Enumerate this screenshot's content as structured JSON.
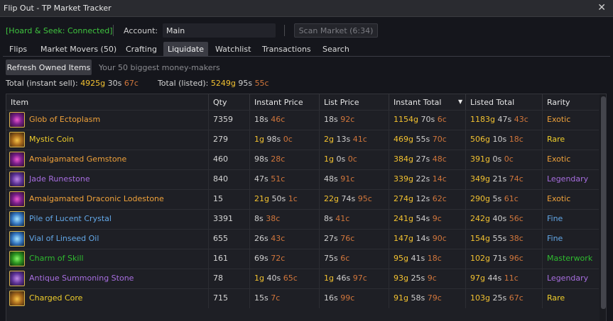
{
  "window": {
    "title": "Flip Out - TP Market Tracker",
    "close_glyph": "✕"
  },
  "connection": {
    "status": "[Hoard & Seek: Connected]",
    "color": "#3fc43f"
  },
  "account": {
    "label": "Account:",
    "value": "Main"
  },
  "scan_button": {
    "label": "Scan Market (6:34)"
  },
  "tabs": [
    {
      "label": "Flips",
      "active": false
    },
    {
      "label": "Market Movers (50)",
      "active": false
    },
    {
      "label": "Crafting",
      "active": false
    },
    {
      "label": "Liquidate",
      "active": true
    },
    {
      "label": "Watchlist",
      "active": false
    },
    {
      "label": "Transactions",
      "active": false
    },
    {
      "label": "Search",
      "active": false
    }
  ],
  "refresh_button": {
    "label": "Refresh Owned Items"
  },
  "hint": "Your 50 biggest money-makers",
  "totals": {
    "instant_label": "Total (instant sell):",
    "instant": {
      "g": "4925g",
      "s": "30s",
      "c": "67c"
    },
    "listed_label": "Total (listed):",
    "listed": {
      "g": "5249g",
      "s": "95s",
      "c": "55c"
    }
  },
  "table": {
    "columns": [
      "Item",
      "Qty",
      "Instant Price",
      "List Price",
      "Instant Total",
      "Listed Total",
      "Rarity"
    ],
    "sort_indicator": "▼",
    "rows": [
      {
        "icon": "glob-of-ectoplasm-icon",
        "name": "Glob of Ectoplasm",
        "qty": "7359",
        "instant": [
          "",
          "18s",
          "46c"
        ],
        "list": [
          "",
          "18s",
          "92c"
        ],
        "itotal": [
          "1154g",
          "70s",
          "6c"
        ],
        "ltotal": [
          "1183g",
          "47s",
          "43c"
        ],
        "rarity": "Exotic"
      },
      {
        "icon": "mystic-coin-icon",
        "name": "Mystic Coin",
        "qty": "279",
        "instant": [
          "1g",
          "98s",
          "0c"
        ],
        "list": [
          "2g",
          "13s",
          "41c"
        ],
        "itotal": [
          "469g",
          "55s",
          "70c"
        ],
        "ltotal": [
          "506g",
          "10s",
          "18c"
        ],
        "rarity": "Rare"
      },
      {
        "icon": "amalgamated-gemstone-icon",
        "name": "Amalgamated Gemstone",
        "qty": "460",
        "instant": [
          "",
          "98s",
          "28c"
        ],
        "list": [
          "1g",
          "0s",
          "0c"
        ],
        "itotal": [
          "384g",
          "27s",
          "48c"
        ],
        "ltotal": [
          "391g",
          "0s",
          "0c"
        ],
        "rarity": "Exotic"
      },
      {
        "icon": "jade-runestone-icon",
        "name": "Jade Runestone",
        "qty": "840",
        "instant": [
          "",
          "47s",
          "51c"
        ],
        "list": [
          "",
          "48s",
          "91c"
        ],
        "itotal": [
          "339g",
          "22s",
          "14c"
        ],
        "ltotal": [
          "349g",
          "21s",
          "74c"
        ],
        "rarity": "Legendary"
      },
      {
        "icon": "amalgamated-draconic-lodestone-icon",
        "name": "Amalgamated Draconic Lodestone",
        "qty": "15",
        "instant": [
          "21g",
          "50s",
          "1c"
        ],
        "list": [
          "22g",
          "74s",
          "95c"
        ],
        "itotal": [
          "274g",
          "12s",
          "62c"
        ],
        "ltotal": [
          "290g",
          "5s",
          "61c"
        ],
        "rarity": "Exotic"
      },
      {
        "icon": "pile-of-lucent-crystal-icon",
        "name": "Pile of Lucent Crystal",
        "qty": "3391",
        "instant": [
          "",
          "8s",
          "38c"
        ],
        "list": [
          "",
          "8s",
          "41c"
        ],
        "itotal": [
          "241g",
          "54s",
          "9c"
        ],
        "ltotal": [
          "242g",
          "40s",
          "56c"
        ],
        "rarity": "Fine"
      },
      {
        "icon": "vial-of-linseed-oil-icon",
        "name": "Vial of Linseed Oil",
        "qty": "655",
        "instant": [
          "",
          "26s",
          "43c"
        ],
        "list": [
          "",
          "27s",
          "76c"
        ],
        "itotal": [
          "147g",
          "14s",
          "90c"
        ],
        "ltotal": [
          "154g",
          "55s",
          "38c"
        ],
        "rarity": "Fine"
      },
      {
        "icon": "charm-of-skill-icon",
        "name": "Charm of Skill",
        "qty": "161",
        "instant": [
          "",
          "69s",
          "72c"
        ],
        "list": [
          "",
          "75s",
          "6c"
        ],
        "itotal": [
          "95g",
          "41s",
          "18c"
        ],
        "ltotal": [
          "102g",
          "71s",
          "96c"
        ],
        "rarity": "Masterwork"
      },
      {
        "icon": "antique-summoning-stone-icon",
        "name": "Antique Summoning Stone",
        "qty": "78",
        "instant": [
          "1g",
          "40s",
          "65c"
        ],
        "list": [
          "1g",
          "46s",
          "97c"
        ],
        "itotal": [
          "93g",
          "25s",
          "9c"
        ],
        "ltotal": [
          "97g",
          "44s",
          "11c"
        ],
        "rarity": "Legendary"
      },
      {
        "icon": "charged-core-icon",
        "name": "Charged Core",
        "qty": "715",
        "instant": [
          "",
          "15s",
          "7c"
        ],
        "list": [
          "",
          "16s",
          "99c"
        ],
        "itotal": [
          "91g",
          "58s",
          "79c"
        ],
        "ltotal": [
          "103g",
          "25s",
          "67c"
        ],
        "rarity": "Rare"
      }
    ]
  },
  "colors": {
    "gold": "#f3c230",
    "silver": "#cfcfcf",
    "copper": "#d1763b",
    "exotic": "#f0a23a",
    "rare": "#f1cf2b",
    "legendary": "#a86ee0",
    "fine": "#63a8e8",
    "masterwork": "#2fbb2f"
  }
}
